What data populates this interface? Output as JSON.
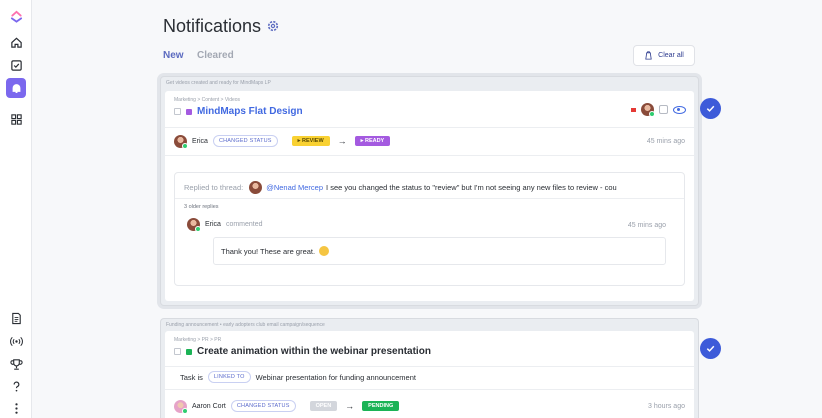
{
  "sidebar": {
    "icons": [
      "clickup-logo-icon",
      "home-icon",
      "checklist-icon",
      "bell-icon",
      "dashboards-icon",
      "document-icon",
      "broadcast-icon",
      "trophy-icon",
      "help-icon",
      "more-icon"
    ]
  },
  "header": {
    "title": "Notifications",
    "settings_icon": "gear-icon",
    "tabs": [
      {
        "label": "New",
        "active": true
      },
      {
        "label": "Cleared",
        "active": false
      }
    ],
    "clear_all_label": "Clear all"
  },
  "notifications": [
    {
      "parent_crumb": "Get videos created and ready for MindMaps LP",
      "crumb": "Marketing  >  Content  >  Videos",
      "title": "MindMaps Flat Design",
      "activity": {
        "user": "Erica",
        "action": "CHANGED STATUS",
        "from_status": "REVIEW",
        "to_status": "READY",
        "arrow": "→",
        "time": "45 mins ago"
      },
      "thread": {
        "replied_label": "Replied to thread:",
        "mention": "@Nenad Mercep",
        "text": "I see you changed the status to \"review\" but I'm not seeing any new files to review - cou",
        "older_replies": "3 older replies",
        "reply_user": "Erica",
        "reply_verb": "commented",
        "reply_time": "45 mins ago",
        "reply_message": "Thank you! These are great."
      }
    },
    {
      "parent_crumb": "Funding announcement • early adopters club email campaign/sequence",
      "crumb": "Marketing  >  PR  >  PR",
      "title": "Create animation within the webinar presentation",
      "linked": {
        "prefix": "Task is",
        "tag": "LINKED TO",
        "target": "Webinar presentation for funding announcement"
      },
      "activity": {
        "user": "Aaron Cort",
        "action": "CHANGED STATUS",
        "from_status": "OPEN",
        "to_status": "PENDING",
        "arrow": "→",
        "time": "3 hours ago"
      }
    }
  ],
  "colors": {
    "accent": "#7b68ee",
    "primary_blue": "#3d5bd9",
    "review": "#f9d132",
    "ready": "#a45ae0",
    "open": "#d3d6dc",
    "pending": "#1bb356"
  }
}
